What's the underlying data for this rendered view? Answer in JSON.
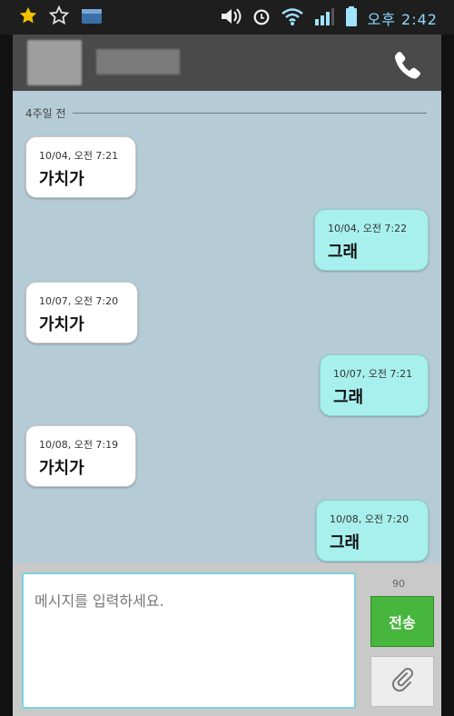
{
  "status_bar": {
    "time": "오후 2:42",
    "notification_icons": [
      "star-icon",
      "star-outline-icon",
      "calendar-badge-icon"
    ],
    "system_icons": [
      "volume-icon",
      "alarm-icon",
      "wifi-icon",
      "signal-icon",
      "battery-icon"
    ]
  },
  "header": {
    "icons": [
      "phone-icon"
    ]
  },
  "chat": {
    "divider_label": "4주일 전",
    "messages": [
      {
        "direction": "incoming",
        "timestamp": "10/04, 오전 7:21",
        "text": "가치가"
      },
      {
        "direction": "outgoing",
        "timestamp": "10/04, 오전 7:22",
        "text": "그래"
      },
      {
        "direction": "incoming",
        "timestamp": "10/07, 오전 7:20",
        "text": "가치가"
      },
      {
        "direction": "outgoing",
        "timestamp": "10/07, 오전 7:21",
        "text": "그래"
      },
      {
        "direction": "incoming",
        "timestamp": "10/08, 오전 7:19",
        "text": "가치가"
      },
      {
        "direction": "outgoing",
        "timestamp": "10/08, 오전 7:20",
        "text": "그래"
      }
    ]
  },
  "composer": {
    "placeholder": "메시지를 입력하세요.",
    "char_counter": "90",
    "send_label": "전송",
    "attach_icon": "paperclip-icon"
  },
  "colors": {
    "chat_background": "#b5cbd5",
    "incoming_bubble": "#ffffff",
    "outgoing_bubble": "#a7f0ed",
    "send_button": "#46b63c"
  }
}
